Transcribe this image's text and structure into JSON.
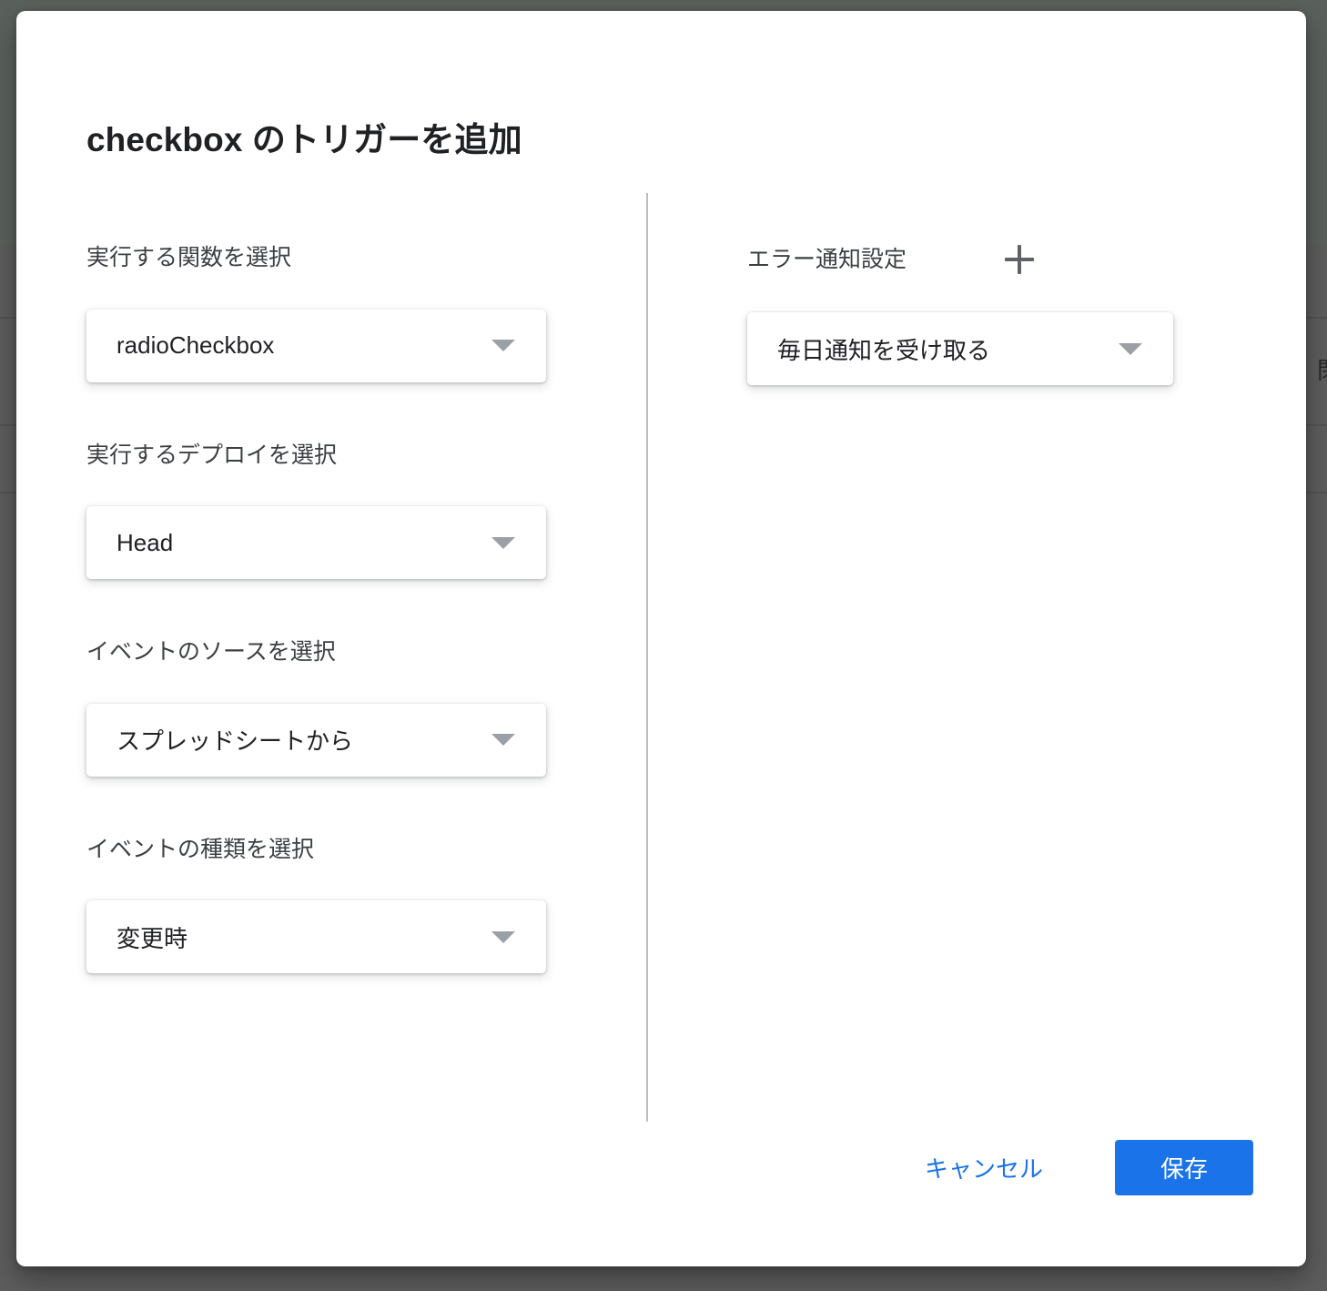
{
  "backdrop": {
    "scrim_color": "#5d5d5d",
    "scrim_tint_color": "#5a615c",
    "partial_glyph": "閉"
  },
  "dialog": {
    "title_strong": "checkbox",
    "title_rest": " のトリガーを追加",
    "accent_color": "#1a73e8"
  },
  "left_column": {
    "fields": [
      {
        "label": "実行する関数を選択",
        "value": "radioCheckbox",
        "name": "function-select"
      },
      {
        "label": "実行するデプロイを選択",
        "value": "Head",
        "name": "deployment-select"
      },
      {
        "label": "イベントのソースを選択",
        "value": "スプレッドシートから",
        "name": "event-source-select"
      },
      {
        "label": "イベントの種類を選択",
        "value": "変更時",
        "name": "event-type-select"
      }
    ]
  },
  "right_column": {
    "label": "エラー通知設定",
    "add_icon": "plus-icon",
    "notification": {
      "value": "毎日通知を受け取る",
      "name": "error-notification-select"
    }
  },
  "footer": {
    "cancel_label": "キャンセル",
    "save_label": "保存"
  }
}
